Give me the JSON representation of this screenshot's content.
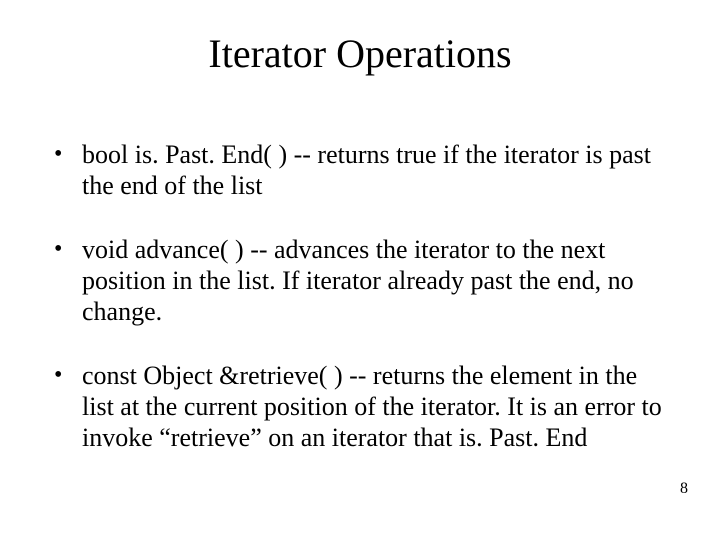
{
  "title": "Iterator Operations",
  "bullets": [
    "bool is. Past. End( ) -- returns true if the iterator is past the end of the list",
    "void advance( ) -- advances the iterator to the next position in the list. If iterator already past the end, no change.",
    "const Object &retrieve( ) -- returns the element in the list at the current position of the iterator.  It is an error to invoke “retrieve” on an iterator that is. Past. End"
  ],
  "page_number": "8"
}
